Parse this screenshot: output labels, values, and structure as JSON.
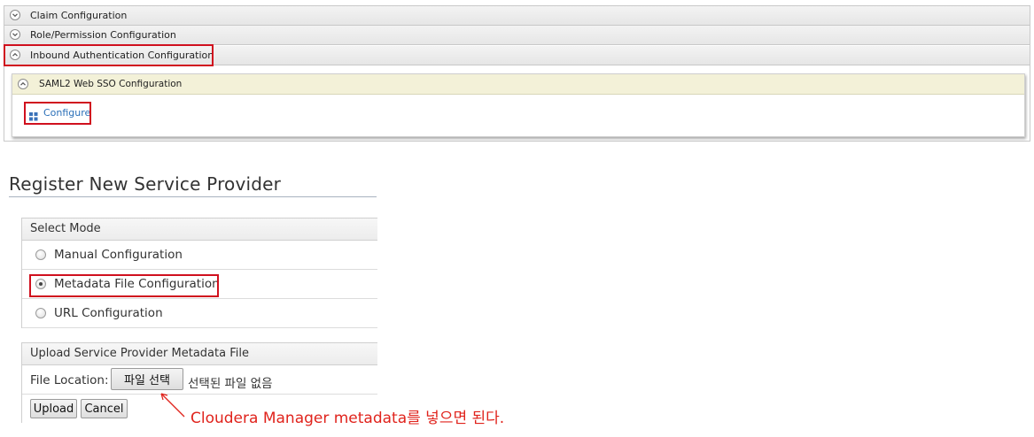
{
  "accordion": {
    "claim_configuration": "Claim Configuration",
    "role_permission_configuration": "Role/Permission Configuration",
    "inbound_auth_configuration": "Inbound Authentication Configuration",
    "saml2_web_sso_configuration": "SAML2 Web SSO Configuration",
    "configure_link": "Configure"
  },
  "register": {
    "title": "Register New Service Provider",
    "select_mode": {
      "header": "Select Mode",
      "options": [
        {
          "label": "Manual Configuration",
          "checked": false
        },
        {
          "label": "Metadata File Configuration",
          "checked": true
        },
        {
          "label": "URL Configuration",
          "checked": false
        }
      ]
    },
    "upload": {
      "header": "Upload Service Provider Metadata File",
      "file_location_label": "File Location:",
      "choose_file_button": "파일 선택",
      "no_file_text": "선택된 파일 없음",
      "upload_button": "Upload",
      "cancel_button": "Cancel"
    }
  },
  "annotation": {
    "note": "Cloudera Manager metadata를 넣으면 된다.",
    "color": "#e0231c"
  },
  "colors": {
    "highlight_border": "#d0101e",
    "link": "#2a6fb8",
    "saml_header_bg": "#f3f1d8"
  }
}
